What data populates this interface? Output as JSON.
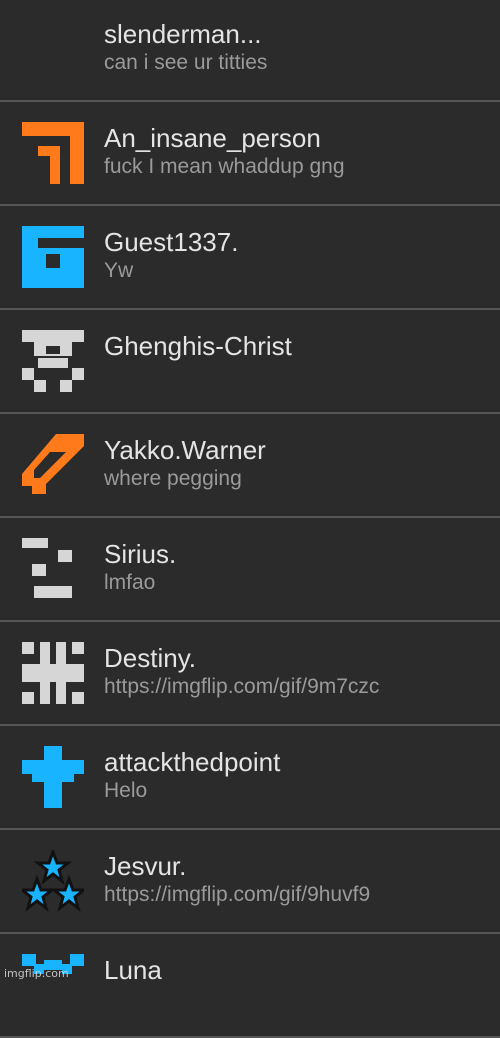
{
  "conversations": [
    {
      "name": "slenderman...",
      "preview": "can i see ur titties",
      "avatar": "none-icon"
    },
    {
      "name": "An_insane_person",
      "preview": "fuck I mean whaddup gng",
      "avatar": "orange-corner-icon",
      "color": "#ff7a1a"
    },
    {
      "name": "Guest1337.",
      "preview": "Yw",
      "avatar": "blue-g-icon",
      "color": "#18b4ff"
    },
    {
      "name": "Ghenghis-Christ",
      "preview": "",
      "avatar": "gray-skull-icon",
      "color": "#d6d6d6"
    },
    {
      "name": "Yakko.Warner",
      "preview": "where pegging",
      "avatar": "orange-diamond-icon",
      "color": "#ff7a1a"
    },
    {
      "name": "Sirius.",
      "preview": "lmfao",
      "avatar": "gray-blocks-icon",
      "color": "#d6d6d6"
    },
    {
      "name": "Destiny.",
      "preview": "https://imgflip.com/gif/9m7czc",
      "avatar": "gray-cross-icon",
      "color": "#d6d6d6"
    },
    {
      "name": "attackthedpoint",
      "preview": "Helo",
      "avatar": "blue-cross-icon",
      "color": "#18b4ff"
    },
    {
      "name": "Jesvur.",
      "preview": "https://imgflip.com/gif/9huvf9",
      "avatar": "stars-icon",
      "color": "#18b4ff"
    },
    {
      "name": "Luna",
      "preview": "",
      "avatar": "blue-pattern-icon",
      "color": "#18b4ff"
    }
  ],
  "watermark": "imgflip.com"
}
